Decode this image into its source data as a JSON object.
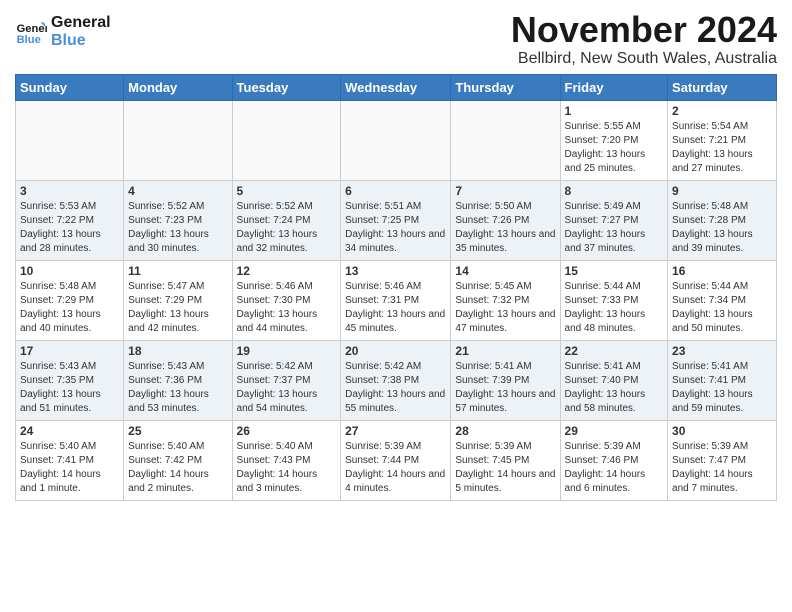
{
  "header": {
    "logo_line1": "General",
    "logo_line2": "Blue",
    "month": "November 2024",
    "location": "Bellbird, New South Wales, Australia"
  },
  "weekdays": [
    "Sunday",
    "Monday",
    "Tuesday",
    "Wednesday",
    "Thursday",
    "Friday",
    "Saturday"
  ],
  "weeks": [
    [
      {
        "day": "",
        "empty": true
      },
      {
        "day": "",
        "empty": true
      },
      {
        "day": "",
        "empty": true
      },
      {
        "day": "",
        "empty": true
      },
      {
        "day": "",
        "empty": true
      },
      {
        "day": "1",
        "sunrise": "5:55 AM",
        "sunset": "7:20 PM",
        "daylight": "13 hours and 25 minutes."
      },
      {
        "day": "2",
        "sunrise": "5:54 AM",
        "sunset": "7:21 PM",
        "daylight": "13 hours and 27 minutes."
      }
    ],
    [
      {
        "day": "3",
        "sunrise": "5:53 AM",
        "sunset": "7:22 PM",
        "daylight": "13 hours and 28 minutes."
      },
      {
        "day": "4",
        "sunrise": "5:52 AM",
        "sunset": "7:23 PM",
        "daylight": "13 hours and 30 minutes."
      },
      {
        "day": "5",
        "sunrise": "5:52 AM",
        "sunset": "7:24 PM",
        "daylight": "13 hours and 32 minutes."
      },
      {
        "day": "6",
        "sunrise": "5:51 AM",
        "sunset": "7:25 PM",
        "daylight": "13 hours and 34 minutes."
      },
      {
        "day": "7",
        "sunrise": "5:50 AM",
        "sunset": "7:26 PM",
        "daylight": "13 hours and 35 minutes."
      },
      {
        "day": "8",
        "sunrise": "5:49 AM",
        "sunset": "7:27 PM",
        "daylight": "13 hours and 37 minutes."
      },
      {
        "day": "9",
        "sunrise": "5:48 AM",
        "sunset": "7:28 PM",
        "daylight": "13 hours and 39 minutes."
      }
    ],
    [
      {
        "day": "10",
        "sunrise": "5:48 AM",
        "sunset": "7:29 PM",
        "daylight": "13 hours and 40 minutes."
      },
      {
        "day": "11",
        "sunrise": "5:47 AM",
        "sunset": "7:29 PM",
        "daylight": "13 hours and 42 minutes."
      },
      {
        "day": "12",
        "sunrise": "5:46 AM",
        "sunset": "7:30 PM",
        "daylight": "13 hours and 44 minutes."
      },
      {
        "day": "13",
        "sunrise": "5:46 AM",
        "sunset": "7:31 PM",
        "daylight": "13 hours and 45 minutes."
      },
      {
        "day": "14",
        "sunrise": "5:45 AM",
        "sunset": "7:32 PM",
        "daylight": "13 hours and 47 minutes."
      },
      {
        "day": "15",
        "sunrise": "5:44 AM",
        "sunset": "7:33 PM",
        "daylight": "13 hours and 48 minutes."
      },
      {
        "day": "16",
        "sunrise": "5:44 AM",
        "sunset": "7:34 PM",
        "daylight": "13 hours and 50 minutes."
      }
    ],
    [
      {
        "day": "17",
        "sunrise": "5:43 AM",
        "sunset": "7:35 PM",
        "daylight": "13 hours and 51 minutes."
      },
      {
        "day": "18",
        "sunrise": "5:43 AM",
        "sunset": "7:36 PM",
        "daylight": "13 hours and 53 minutes."
      },
      {
        "day": "19",
        "sunrise": "5:42 AM",
        "sunset": "7:37 PM",
        "daylight": "13 hours and 54 minutes."
      },
      {
        "day": "20",
        "sunrise": "5:42 AM",
        "sunset": "7:38 PM",
        "daylight": "13 hours and 55 minutes."
      },
      {
        "day": "21",
        "sunrise": "5:41 AM",
        "sunset": "7:39 PM",
        "daylight": "13 hours and 57 minutes."
      },
      {
        "day": "22",
        "sunrise": "5:41 AM",
        "sunset": "7:40 PM",
        "daylight": "13 hours and 58 minutes."
      },
      {
        "day": "23",
        "sunrise": "5:41 AM",
        "sunset": "7:41 PM",
        "daylight": "13 hours and 59 minutes."
      }
    ],
    [
      {
        "day": "24",
        "sunrise": "5:40 AM",
        "sunset": "7:41 PM",
        "daylight": "14 hours and 1 minute."
      },
      {
        "day": "25",
        "sunrise": "5:40 AM",
        "sunset": "7:42 PM",
        "daylight": "14 hours and 2 minutes."
      },
      {
        "day": "26",
        "sunrise": "5:40 AM",
        "sunset": "7:43 PM",
        "daylight": "14 hours and 3 minutes."
      },
      {
        "day": "27",
        "sunrise": "5:39 AM",
        "sunset": "7:44 PM",
        "daylight": "14 hours and 4 minutes."
      },
      {
        "day": "28",
        "sunrise": "5:39 AM",
        "sunset": "7:45 PM",
        "daylight": "14 hours and 5 minutes."
      },
      {
        "day": "29",
        "sunrise": "5:39 AM",
        "sunset": "7:46 PM",
        "daylight": "14 hours and 6 minutes."
      },
      {
        "day": "30",
        "sunrise": "5:39 AM",
        "sunset": "7:47 PM",
        "daylight": "14 hours and 7 minutes."
      }
    ]
  ]
}
